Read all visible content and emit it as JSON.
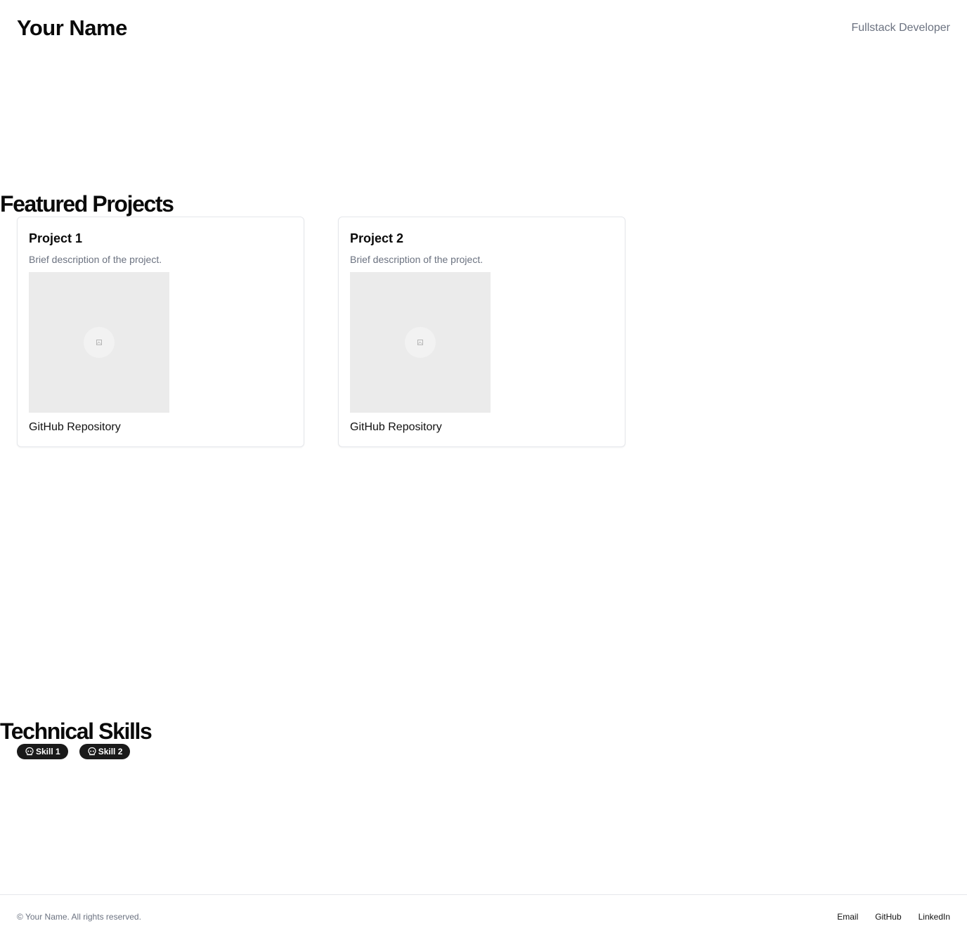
{
  "header": {
    "name": "Your Name",
    "role": "Fullstack Developer"
  },
  "projects": {
    "heading": "Featured Projects",
    "items": [
      {
        "title": "Project 1",
        "description": "Brief description of the project.",
        "link_label": "GitHub Repository",
        "image_icon": "image-icon"
      },
      {
        "title": "Project 2",
        "description": "Brief description of the project.",
        "link_label": "GitHub Repository",
        "image_icon": "image-icon"
      }
    ]
  },
  "skills": {
    "heading": "Technical Skills",
    "items": [
      {
        "label": "Skill 1",
        "icon": "skull-icon"
      },
      {
        "label": "Skill 2",
        "icon": "skull-icon"
      }
    ]
  },
  "footer": {
    "copyright": "© Your Name. All rights reserved.",
    "links": [
      "Email",
      "GitHub",
      "LinkedIn"
    ]
  }
}
